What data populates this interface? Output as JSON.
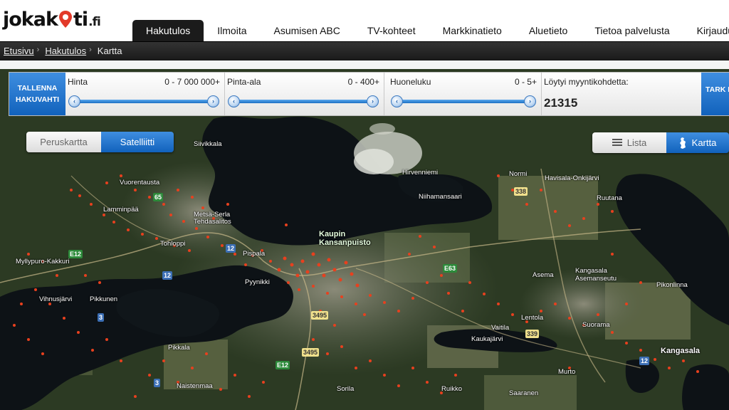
{
  "logo": {
    "text_before": "jokak",
    "text_after": "ti",
    "suffix": ".fi"
  },
  "nav": [
    {
      "label": "Hakutulos",
      "active": true
    },
    {
      "label": "Ilmoita",
      "active": false
    },
    {
      "label": "Asumisen ABC",
      "active": false
    },
    {
      "label": "TV-kohteet",
      "active": false
    },
    {
      "label": "Markkinatieto",
      "active": false
    },
    {
      "label": "Aluetieto",
      "active": false
    },
    {
      "label": "Tietoa palvelusta",
      "active": false
    },
    {
      "label": "Kirjaudu",
      "active": false
    }
  ],
  "breadcrumb": {
    "home": "Etusivu",
    "results": "Hakutulos",
    "current": "Kartta",
    "separator": "›"
  },
  "filters": {
    "save_button": "TALLENNA HAKUVAHTI",
    "price": {
      "label": "Hinta",
      "range": "0 - 7 000 000+"
    },
    "area": {
      "label": "Pinta-ala",
      "range": "0 - 400+"
    },
    "rooms": {
      "label": "Huoneluku",
      "range": "0 - 5+"
    },
    "results_label": "Löytyi myyntikohdetta:",
    "results_count": "21315",
    "right_button": "TARK HAK"
  },
  "map_type": {
    "basic": "Peruskartta",
    "satellite": "Satelliitti",
    "selected": "satellite"
  },
  "view_toggle": {
    "list": "Lista",
    "map": "Kartta",
    "selected": "map"
  },
  "map_labels": {
    "siivikkala": "Siivikkala",
    "vuorentausta": "Vuorentausta",
    "lamminpaa": "Lamminpää",
    "myllypuro": "Myllypuro-Kakkuri",
    "tohloppi": "Tohloppi",
    "vihnusjarvi": "Vihnusjärvi",
    "pikkunen": "Pikkunen",
    "pispala": "Pispala",
    "pyynikki": "Pyynikki",
    "metsa_serla": "Metsä-Serla Tehdasalitos",
    "kaupin": "Kaupin Kansanpuisto",
    "hirvenniemi": "Hirvenniemi",
    "niihamansaari": "Niihamansaari",
    "normi": "Normi",
    "havisala": "Havisala-Onkijärvi",
    "ruutana": "Ruutana",
    "asema": "Asema",
    "kangasala_asemanseutu": "Kangasala Asemanseutu",
    "pikonlinna": "Pikonlinna",
    "lentola": "Lentola",
    "vaitila": "Vaitila",
    "kaukajarvi": "Kaukajärvi",
    "suorama": "Suorama",
    "kangasala": "Kangasala",
    "murto": "Murto",
    "ruikko": "Ruikko",
    "saaranen": "Saaranen",
    "naistenmaa": "Naistenmaa",
    "pikkala": "Pikkala",
    "sorila": "Sorila"
  },
  "road_signs": {
    "r65": "65",
    "r12a": "12",
    "r12b": "12",
    "r3a": "3",
    "r3b": "3",
    "e12a": "E12",
    "e12b": "E12",
    "e63": "E63",
    "r338": "338",
    "r339": "339",
    "r3495a": "3495",
    "r3495b": "3495"
  },
  "colors": {
    "accent": "#1d6fc4",
    "marker": "#e8401e"
  }
}
